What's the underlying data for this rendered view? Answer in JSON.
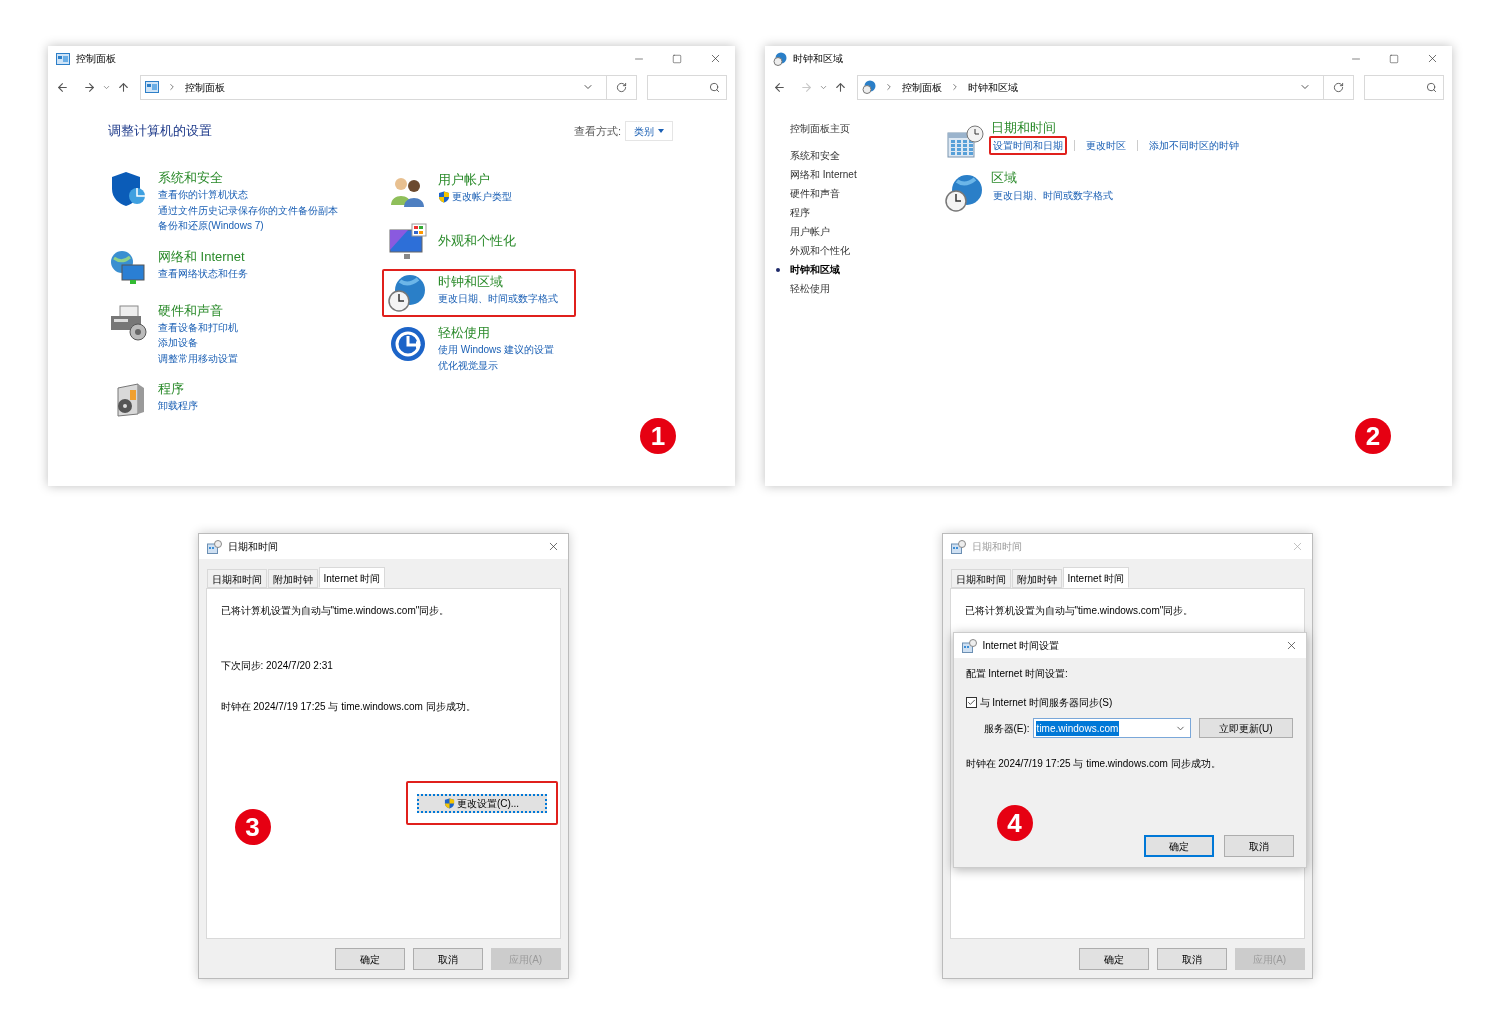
{
  "control_panel": {
    "step": "1",
    "title": "控制面板",
    "breadcrumb": [
      "控制面板"
    ],
    "forward_disabled": false,
    "heading": "调整计算机的设置",
    "view_label": "查看方式:",
    "view_value": "类别",
    "columns": [
      {
        "categories": [
          {
            "title": "系统和安全",
            "highlighted": false,
            "links": [
              {
                "text": "查看你的计算机状态",
                "shield": false
              },
              {
                "text": "通过文件历史记录保存你的文件备份副本",
                "shield": false
              },
              {
                "text": "备份和还原(Windows 7)",
                "shield": false
              }
            ]
          },
          {
            "title": "网络和 Internet",
            "highlighted": false,
            "links": [
              {
                "text": "查看网络状态和任务",
                "shield": false
              }
            ]
          },
          {
            "title": "硬件和声音",
            "highlighted": false,
            "links": [
              {
                "text": "查看设备和打印机",
                "shield": false
              },
              {
                "text": "添加设备",
                "shield": false
              },
              {
                "text": "调整常用移动设置",
                "shield": false
              }
            ]
          },
          {
            "title": "程序",
            "highlighted": false,
            "links": [
              {
                "text": "卸载程序",
                "shield": false
              }
            ]
          }
        ]
      },
      {
        "categories": [
          {
            "title": "用户帐户",
            "highlighted": false,
            "links": [
              {
                "text": "更改帐户类型",
                "shield": true
              }
            ]
          },
          {
            "title": "外观和个性化",
            "highlighted": false
          },
          {
            "title": "时钟和区域",
            "highlighted": true,
            "links": [
              {
                "text": "更改日期、时间或数字格式",
                "shield": false
              }
            ]
          },
          {
            "title": "轻松使用",
            "highlighted": false,
            "links": [
              {
                "text": "使用 Windows 建议的设置",
                "shield": false
              },
              {
                "text": "优化视觉显示",
                "shield": false
              }
            ]
          }
        ]
      }
    ]
  },
  "clock_region": {
    "step": "2",
    "title": "时钟和区域",
    "breadcrumb": [
      "控制面板",
      "时钟和区域"
    ],
    "forward_disabled": true,
    "sidebar": [
      {
        "label": "控制面板主页",
        "selected": false
      },
      {
        "label": "系统和安全",
        "selected": false
      },
      {
        "label": "网络和 Internet",
        "selected": false
      },
      {
        "label": "硬件和声音",
        "selected": false
      },
      {
        "label": "程序",
        "selected": false
      },
      {
        "label": "用户帐户",
        "selected": false
      },
      {
        "label": "外观和个性化",
        "selected": false
      },
      {
        "label": "时钟和区域",
        "selected": true
      },
      {
        "label": "轻松使用",
        "selected": false
      }
    ],
    "sections": [
      {
        "title": "日期和时间",
        "links": [
          {
            "text": "设置时间和日期",
            "highlighted": true
          },
          {
            "text": "更改时区",
            "highlighted": false
          },
          {
            "text": "添加不同时区的时钟",
            "highlighted": false
          }
        ]
      },
      {
        "title": "区域",
        "links": [
          {
            "text": "更改日期、时间或数字格式",
            "highlighted": false
          }
        ]
      }
    ]
  },
  "date_time_dialog": {
    "step": "3",
    "title": "日期和时间",
    "active": true,
    "tabs": [
      {
        "label": "日期和时间",
        "selected": false
      },
      {
        "label": "附加时钟",
        "selected": false
      },
      {
        "label": "Internet 时间",
        "selected": true
      }
    ],
    "lines": [
      "已将计算机设置为自动与\"time.windows.com\"同步。",
      "下次同步: 2024/7/20 2:31",
      "时钟在 2024/7/19 17:25 与 time.windows.com 同步成功。"
    ],
    "change_button": {
      "label": "更改设置(C)...",
      "highlighted": true
    },
    "buttons": [
      {
        "label": "确定",
        "disabled": false
      },
      {
        "label": "取消",
        "disabled": false
      },
      {
        "label": "应用(A)",
        "disabled": true
      }
    ]
  },
  "internet_time_dialog": {
    "step": "4",
    "title": "日期和时间",
    "active": false,
    "tabs": [
      {
        "label": "日期和时间",
        "selected": false
      },
      {
        "label": "附加时钟",
        "selected": false
      },
      {
        "label": "Internet 时间",
        "selected": true
      }
    ],
    "lines": [
      "已将计算机设置为自动与\"time.windows.com\"同步。"
    ],
    "buttons": [
      {
        "label": "确定",
        "disabled": false
      },
      {
        "label": "取消",
        "disabled": false
      },
      {
        "label": "应用(A)",
        "disabled": true
      }
    ],
    "settings_dialog": {
      "title": "Internet 时间设置",
      "intro": "配置 Internet 时间设置:",
      "sync": {
        "label": "与 Internet 时间服务器同步(S)",
        "checked": true
      },
      "server_label": "服务器(E):",
      "server_value": "time.windows.com",
      "update_button": "立即更新(U)",
      "status": "时钟在 2024/7/19 17:25 与 time.windows.com 同步成功。",
      "buttons": [
        {
          "label": "确定",
          "default": true
        },
        {
          "label": "取消",
          "default": false
        }
      ]
    }
  }
}
